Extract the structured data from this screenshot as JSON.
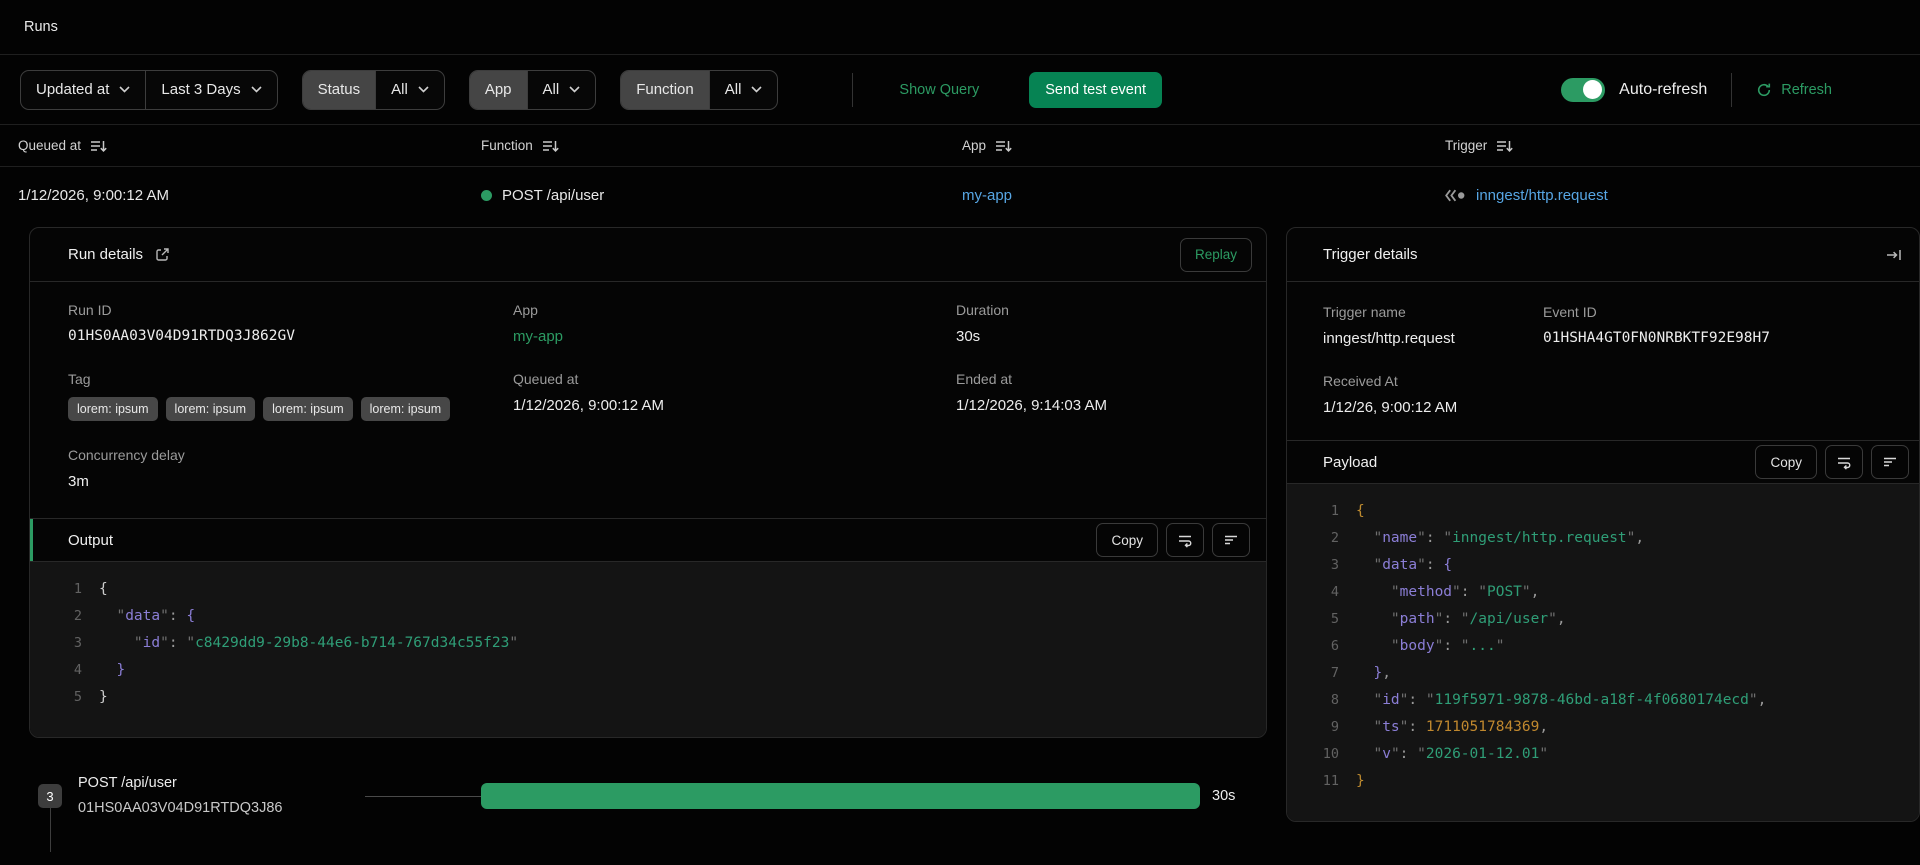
{
  "page": {
    "title": "Runs"
  },
  "filters": {
    "sort_field": "Updated at",
    "time_range": "Last 3 Days",
    "status_label": "Status",
    "status_value": "All",
    "app_label": "App",
    "app_value": "All",
    "function_label": "Function",
    "function_value": "All",
    "show_query": "Show Query",
    "send_test_event": "Send test event",
    "auto_refresh_label": "Auto-refresh",
    "auto_refresh_on": true,
    "refresh_label": "Refresh"
  },
  "table": {
    "columns": [
      "Queued at",
      "Function",
      "App",
      "Trigger"
    ],
    "row": {
      "queued_at": "1/12/2026, 9:00:12 AM",
      "function_name": "POST /api/user",
      "function_status": "completed",
      "app": "my-app",
      "trigger": "inngest/http.request"
    }
  },
  "run_details": {
    "title": "Run details",
    "replay_label": "Replay",
    "run_id": {
      "label": "Run ID",
      "value": "01HS0AA03V04D91RTDQ3J862GV"
    },
    "app": {
      "label": "App",
      "value": "my-app"
    },
    "duration": {
      "label": "Duration",
      "value": "30s"
    },
    "tag": {
      "label": "Tag",
      "badges": [
        "lorem: ipsum",
        "lorem: ipsum",
        "lorem: ipsum",
        "lorem: ipsum"
      ]
    },
    "queued_at": {
      "label": "Queued at",
      "value": "1/12/2026, 9:00:12 AM"
    },
    "ended_at": {
      "label": "Ended at",
      "value": "1/12/2026, 9:14:03 AM"
    },
    "concurrency_delay": {
      "label": "Concurrency delay",
      "value": "3m"
    },
    "output": {
      "title": "Output",
      "copy_label": "Copy",
      "code": [
        [
          {
            "t": "{",
            "y": "b"
          }
        ],
        [
          {
            "t": "  ",
            "y": "w"
          },
          {
            "t": "\"",
            "y": "q"
          },
          {
            "t": "data",
            "y": "k"
          },
          {
            "t": "\"",
            "y": "q"
          },
          {
            "t": ": ",
            "y": "p"
          },
          {
            "t": "{",
            "y": "k"
          }
        ],
        [
          {
            "t": "    ",
            "y": "w"
          },
          {
            "t": "\"",
            "y": "q"
          },
          {
            "t": "id",
            "y": "k"
          },
          {
            "t": "\"",
            "y": "q"
          },
          {
            "t": ": ",
            "y": "p"
          },
          {
            "t": "\"",
            "y": "q"
          },
          {
            "t": "c8429dd9-29b8-44e6-b714-767d34c55f23",
            "y": "s"
          },
          {
            "t": "\"",
            "y": "q"
          }
        ],
        [
          {
            "t": "  ",
            "y": "w"
          },
          {
            "t": "}",
            "y": "k"
          }
        ],
        [
          {
            "t": "}",
            "y": "b"
          }
        ]
      ]
    }
  },
  "timeline": {
    "step_count": "3",
    "step_name": "POST /api/user",
    "step_run_id": "01HS0AA03V04D91RTDQ3J86",
    "duration_label": "30s"
  },
  "trigger_details": {
    "title": "Trigger details",
    "trigger_name": {
      "label": "Trigger name",
      "value": "inngest/http.request"
    },
    "event_id": {
      "label": "Event ID",
      "value": "01HSHA4GT0FN0NRBKTF92E98H7"
    },
    "received_at": {
      "label": "Received At",
      "value": "1/12/26, 9:00:12 AM"
    },
    "payload": {
      "title": "Payload",
      "copy_label": "Copy",
      "code": [
        [
          {
            "t": "{",
            "y": "ba"
          }
        ],
        [
          {
            "t": "  ",
            "y": "w"
          },
          {
            "t": "\"",
            "y": "q"
          },
          {
            "t": "name",
            "y": "k"
          },
          {
            "t": "\"",
            "y": "q"
          },
          {
            "t": ": ",
            "y": "p"
          },
          {
            "t": "\"",
            "y": "q"
          },
          {
            "t": "inngest/http.request",
            "y": "s"
          },
          {
            "t": "\"",
            "y": "q"
          },
          {
            "t": ",",
            "y": "p"
          }
        ],
        [
          {
            "t": "  ",
            "y": "w"
          },
          {
            "t": "\"",
            "y": "q"
          },
          {
            "t": "data",
            "y": "k"
          },
          {
            "t": "\"",
            "y": "q"
          },
          {
            "t": ": ",
            "y": "p"
          },
          {
            "t": "{",
            "y": "k"
          }
        ],
        [
          {
            "t": "    ",
            "y": "w"
          },
          {
            "t": "\"",
            "y": "q"
          },
          {
            "t": "method",
            "y": "k"
          },
          {
            "t": "\"",
            "y": "q"
          },
          {
            "t": ": ",
            "y": "p"
          },
          {
            "t": "\"",
            "y": "q"
          },
          {
            "t": "POST",
            "y": "s"
          },
          {
            "t": "\"",
            "y": "q"
          },
          {
            "t": ",",
            "y": "p"
          }
        ],
        [
          {
            "t": "    ",
            "y": "w"
          },
          {
            "t": "\"",
            "y": "q"
          },
          {
            "t": "path",
            "y": "k"
          },
          {
            "t": "\"",
            "y": "q"
          },
          {
            "t": ": ",
            "y": "p"
          },
          {
            "t": "\"",
            "y": "q"
          },
          {
            "t": "/api/user",
            "y": "s"
          },
          {
            "t": "\"",
            "y": "q"
          },
          {
            "t": ",",
            "y": "p"
          }
        ],
        [
          {
            "t": "    ",
            "y": "w"
          },
          {
            "t": "\"",
            "y": "q"
          },
          {
            "t": "body",
            "y": "k"
          },
          {
            "t": "\"",
            "y": "q"
          },
          {
            "t": ": ",
            "y": "p"
          },
          {
            "t": "\"",
            "y": "q"
          },
          {
            "t": "...",
            "y": "s"
          },
          {
            "t": "\"",
            "y": "q"
          }
        ],
        [
          {
            "t": "  ",
            "y": "w"
          },
          {
            "t": "}",
            "y": "k"
          },
          {
            "t": ",",
            "y": "p"
          }
        ],
        [
          {
            "t": "  ",
            "y": "w"
          },
          {
            "t": "\"",
            "y": "q"
          },
          {
            "t": "id",
            "y": "k"
          },
          {
            "t": "\"",
            "y": "q"
          },
          {
            "t": ": ",
            "y": "p"
          },
          {
            "t": "\"",
            "y": "q"
          },
          {
            "t": "119f5971-9878-46bd-a18f-4f0680174ecd",
            "y": "s"
          },
          {
            "t": "\"",
            "y": "q"
          },
          {
            "t": ",",
            "y": "p"
          }
        ],
        [
          {
            "t": "  ",
            "y": "w"
          },
          {
            "t": "\"",
            "y": "q"
          },
          {
            "t": "ts",
            "y": "k"
          },
          {
            "t": "\"",
            "y": "q"
          },
          {
            "t": ": ",
            "y": "p"
          },
          {
            "t": "1711051784369",
            "y": "n"
          },
          {
            "t": ",",
            "y": "p"
          }
        ],
        [
          {
            "t": "  ",
            "y": "w"
          },
          {
            "t": "\"",
            "y": "q"
          },
          {
            "t": "v",
            "y": "k"
          },
          {
            "t": "\"",
            "y": "q"
          },
          {
            "t": ": ",
            "y": "p"
          },
          {
            "t": "\"",
            "y": "q"
          },
          {
            "t": "2026-01-12.01",
            "y": "s"
          },
          {
            "t": "\"",
            "y": "q"
          }
        ],
        [
          {
            "t": "}",
            "y": "ba"
          }
        ]
      ]
    }
  },
  "colors": {
    "accent_green": "#2c9b63",
    "button_green": "#068353",
    "link_blue": "#57a6e4",
    "code_key_purple": "#8b7ed6",
    "code_string_green": "#2f9e77",
    "code_number_amber": "#c0882e",
    "tag_bg": "#474747",
    "panel_border": "#282828"
  }
}
